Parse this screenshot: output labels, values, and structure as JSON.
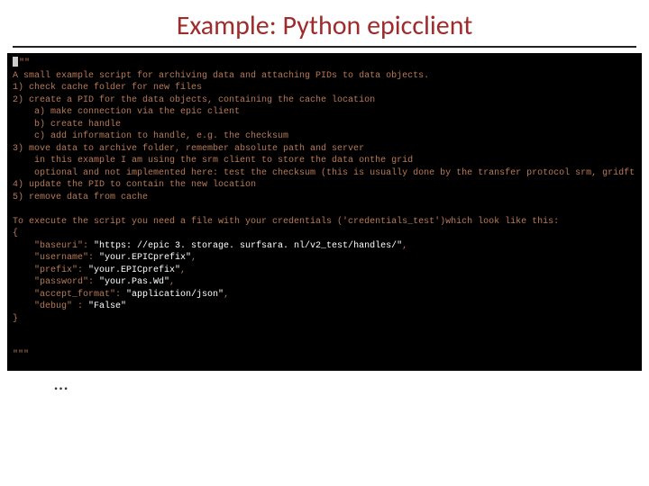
{
  "title": "Example: Python epicclient",
  "code": {
    "dq_open": "\"\"",
    "l1": "A small example script for archiving data and attaching PIDs to data objects.",
    "l2": "1) check cache folder for new files",
    "l3": "2) create a PID for the data objects, containing the cache location",
    "l4": "    a) make connection via the epic client",
    "l5": "    b) create handle",
    "l6": "    c) add information to handle, e.g. the checksum",
    "l7": "3) move data to archive folder, remember absolute path and server",
    "l8": "    in this example I am using the srm client to store the data onthe grid",
    "l9": "    optional and not implemented here: test the checksum (this is usually done by the transfer protocol srm, gridft ...)",
    "l10": "4) update the PID to contain the new location",
    "l11": "5) remove data from cache",
    "blank1": " ",
    "l12": "To execute the script you need a file with your credentials ('credentials_test')which look like this:",
    "l13": "{",
    "l14a": "    \"baseuri\": ",
    "l14b": "\"https: //epic 3. storage. surfsara. nl/v2_test/handles/\"",
    "l14c": ",",
    "l15a": "    \"username\": ",
    "l15b": "\"your.EPICprefix\"",
    "l15c": ",",
    "l16a": "    \"prefix\": ",
    "l16b": "\"your.EPICprefix\"",
    "l16c": ",",
    "l17a": "    \"password\": ",
    "l17b": "\"your.Pas.Wd\"",
    "l17c": ",",
    "l18a": "    \"accept_format\": ",
    "l18b": "\"application/json\"",
    "l18c": ",",
    "l19a": "    \"debug\" : ",
    "l19b": "\"False\"",
    "l20": "}",
    "blank2": " ",
    "blank3": " ",
    "dq_close": "\"\"\""
  },
  "ellipsis": "…"
}
